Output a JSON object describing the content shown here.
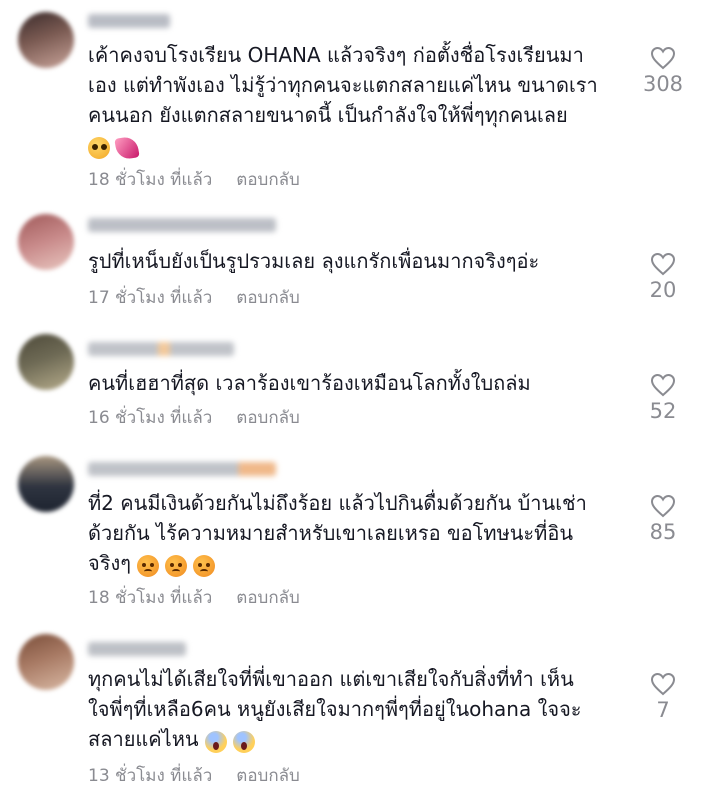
{
  "like_color": "#8a8b91",
  "meta_color": "#8a8b91",
  "comments": [
    {
      "avatar_colors": [
        "#3a2b2b",
        "#c9a49a"
      ],
      "username_color": "#b9bcc4",
      "text": "เค้าคงจบโรงเรียน OHANA แล้วจริงๆ ก่อตั้งชื่อโรงเรียนมา\nเอง แต่ทำพังเอง ไม่รู้ว่าทุกคนจะแตกสลายแค่ไหน ขนาดเรา\nคนนอก ยังแตกสลายขนาดนี้ เป็นกำลังใจให้พี่ๆทุกคนเลย",
      "emojis": [
        "pleading-face",
        "heart-with-ribbon"
      ],
      "time": "18 ชั่วโมง ที่แล้ว",
      "reply": "ตอบกลับ",
      "likes": "308"
    },
    {
      "avatar_colors": [
        "#c98b8b",
        "#e9c7c0"
      ],
      "username_color": "#bcbfc6",
      "text": "รูปที่เหน็บยังเป็นรูปรวมเลย ลุงแกรักเพื่อนมากจริงๆอ่ะ",
      "emojis": [],
      "time": "17 ชั่วโมง ที่แล้ว",
      "reply": "ตอบกลับ",
      "likes": "20"
    },
    {
      "avatar_colors": [
        "#6e6a55",
        "#b7ad8c"
      ],
      "username_color": "#c0c3c9",
      "text": "คนที่เฮฮาที่สุด เวลาร้องเขาร้องเหมือนโลกทั้งใบถล่ม",
      "emojis": [],
      "time": "16 ชั่วโมง ที่แล้ว",
      "reply": "ตอบกลับ",
      "likes": "52"
    },
    {
      "avatar_colors": [
        "#2e3440",
        "#a89680"
      ],
      "username_color": "#bfc2c8",
      "text": "ที่2 คนมีเงินด้วยกันไม่ถึงร้อย แล้วไปกินดื่มด้วยกัน บ้านเช่า\nด้วยกัน ไร้ความหมายสำหรับเขาเลยเหรอ ขอโทษนะที่อิน\nจริงๆ",
      "emojis": [
        "angry-face",
        "angry-face",
        "angry-face"
      ],
      "time": "18 ชั่วโมง ที่แล้ว",
      "reply": "ตอบกลับ",
      "likes": "85"
    },
    {
      "avatar_colors": [
        "#7a4e3a",
        "#d9b9a4"
      ],
      "username_color": "#bdc0c6",
      "text": "ทุกคนไม่ได้เสียใจที่พี่เขาออก แต่เขาเสียใจกับสิ่งที่ทำ เห็น\nใจพี่ๆที่เหลือ6คน หนูยังเสียใจมากๆพี่ๆที่อยู่ในohana ใจจะ\nสลายแค่ไหน",
      "emojis": [
        "screaming-face",
        "screaming-face"
      ],
      "time": "13 ชั่วโมง ที่แล้ว",
      "reply": "ตอบกลับ",
      "likes": "7"
    }
  ]
}
